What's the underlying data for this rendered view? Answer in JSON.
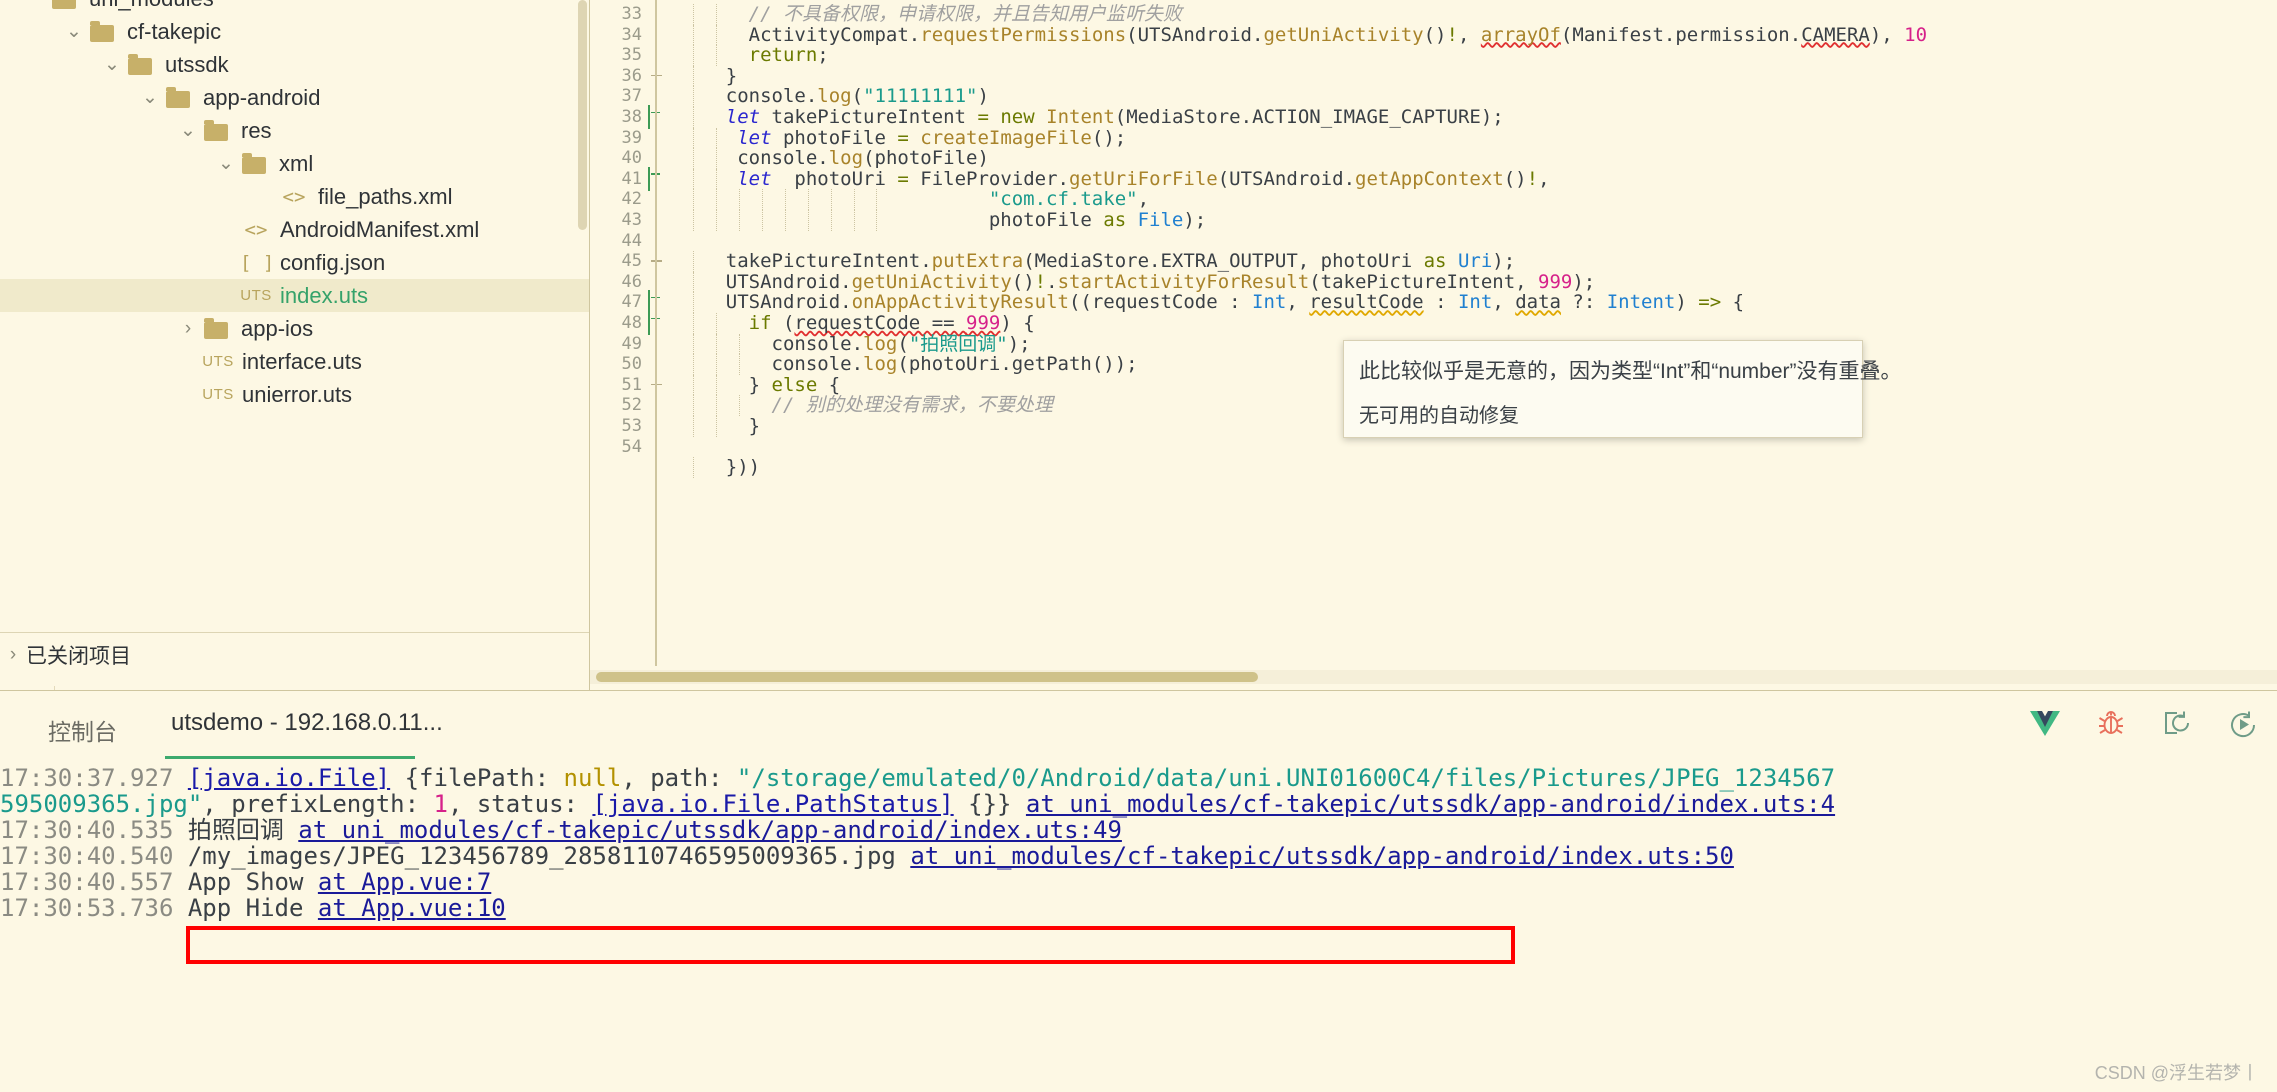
{
  "sidebar": {
    "tree": [
      {
        "indent": 0,
        "twisty": "",
        "icon": "folder",
        "label": "uni_modules",
        "selected": false,
        "clipped": true
      },
      {
        "indent": 1,
        "twisty": "chevron-down",
        "icon": "folder",
        "label": "cf-takepic",
        "selected": false
      },
      {
        "indent": 2,
        "twisty": "chevron-down",
        "icon": "folder",
        "label": "utssdk",
        "selected": false
      },
      {
        "indent": 3,
        "twisty": "chevron-down",
        "icon": "folder",
        "label": "app-android",
        "selected": false
      },
      {
        "indent": 4,
        "twisty": "chevron-down",
        "icon": "folder",
        "label": "res",
        "selected": false
      },
      {
        "indent": 5,
        "twisty": "chevron-down",
        "icon": "folder",
        "label": "xml",
        "selected": false
      },
      {
        "indent": 6,
        "twisty": "",
        "icon": "code",
        "label": "file_paths.xml",
        "selected": false
      },
      {
        "indent": 5,
        "twisty": "",
        "icon": "code",
        "label": "AndroidManifest.xml",
        "selected": false
      },
      {
        "indent": 5,
        "twisty": "",
        "icon": "json",
        "label": "config.json",
        "selected": false
      },
      {
        "indent": 5,
        "twisty": "",
        "icon": "uts",
        "label": "index.uts",
        "selected": true
      },
      {
        "indent": 4,
        "twisty": "chevron-right",
        "icon": "folder",
        "label": "app-ios",
        "selected": false
      },
      {
        "indent": 4,
        "twisty": "",
        "icon": "uts",
        "label": "interface.uts",
        "selected": false
      },
      {
        "indent": 4,
        "twisty": "",
        "icon": "uts",
        "label": "unierror.uts",
        "selected": false
      }
    ],
    "closed_projects": {
      "twisty": "chevron-right",
      "label": "已关闭项目"
    },
    "toolbar": [
      {
        "name": "project-manager-icon",
        "glyph": "folder-lines"
      },
      {
        "name": "binoculars-icon",
        "glyph": "binoculars"
      },
      {
        "name": "bug-icon",
        "glyph": "bug"
      },
      {
        "name": "run-icon",
        "glyph": "run-arrow"
      },
      {
        "name": "cloud-globe-icon",
        "glyph": "cloud-globe"
      }
    ]
  },
  "editor": {
    "lines": [
      {
        "num": "33",
        "fold": "",
        "indent": 2,
        "tokens": [
          {
            "t": "      // 不具备权限，申请权限，并且告知用户监听失败",
            "c": "c-cmt"
          }
        ]
      },
      {
        "num": "34",
        "fold": "",
        "indent": 2,
        "tokens": [
          {
            "t": "      ",
            "c": "c-pln"
          },
          {
            "t": "ActivityCompat",
            "c": "c-pln"
          },
          {
            "t": ".",
            "c": "c-punct"
          },
          {
            "t": "requestPermissions",
            "c": "c-fn"
          },
          {
            "t": "(",
            "c": "c-punct"
          },
          {
            "t": "UTSAndroid",
            "c": "c-pln"
          },
          {
            "t": ".",
            "c": "c-punct"
          },
          {
            "t": "getUniActivity",
            "c": "c-fn"
          },
          {
            "t": "()",
            "c": "c-punct"
          },
          {
            "t": "!",
            "c": "c-op"
          },
          {
            "t": ", ",
            "c": "c-punct"
          },
          {
            "t": "arrayOf",
            "c": "c-fn sq-red"
          },
          {
            "t": "(",
            "c": "c-punct"
          },
          {
            "t": "Manifest",
            "c": "c-pln"
          },
          {
            "t": ".",
            "c": "c-punct"
          },
          {
            "t": "permission",
            "c": "c-pln"
          },
          {
            "t": ".",
            "c": "c-punct"
          },
          {
            "t": "CAMERA",
            "c": "c-pln sq-red"
          },
          {
            "t": "), ",
            "c": "c-punct"
          },
          {
            "t": "10",
            "c": "c-num"
          }
        ]
      },
      {
        "num": "35",
        "fold": "",
        "indent": 2,
        "tokens": [
          {
            "t": "      ",
            "c": "c-pln"
          },
          {
            "t": "return",
            "c": "c-kw2"
          },
          {
            "t": ";",
            "c": "c-punct"
          }
        ]
      },
      {
        "num": "36",
        "fold": "dash",
        "indent": 1,
        "tokens": [
          {
            "t": "    }",
            "c": "c-punct"
          }
        ]
      },
      {
        "num": "37",
        "fold": "",
        "indent": 1,
        "tokens": [
          {
            "t": "    console",
            "c": "c-pln"
          },
          {
            "t": ".",
            "c": "c-punct"
          },
          {
            "t": "log",
            "c": "c-fn"
          },
          {
            "t": "(",
            "c": "c-punct"
          },
          {
            "t": "\"11111111\"",
            "c": "c-str"
          },
          {
            "t": ")",
            "c": "c-punct"
          }
        ]
      },
      {
        "num": "38",
        "fold": "box",
        "indent": 1,
        "tokens": [
          {
            "t": "    ",
            "c": "c-pln"
          },
          {
            "t": "let",
            "c": "c-kw"
          },
          {
            "t": " takePictureIntent ",
            "c": "c-pln"
          },
          {
            "t": "=",
            "c": "c-op"
          },
          {
            "t": " ",
            "c": "c-pln"
          },
          {
            "t": "new",
            "c": "c-kw2"
          },
          {
            "t": " ",
            "c": "c-pln"
          },
          {
            "t": "Intent",
            "c": "c-fn"
          },
          {
            "t": "(",
            "c": "c-punct"
          },
          {
            "t": "MediaStore",
            "c": "c-pln"
          },
          {
            "t": ".",
            "c": "c-punct"
          },
          {
            "t": "ACTION_IMAGE_CAPTURE",
            "c": "c-pln"
          },
          {
            "t": ");",
            "c": "c-punct"
          }
        ]
      },
      {
        "num": "39",
        "fold": "",
        "indent": 2,
        "tokens": [
          {
            "t": "     ",
            "c": "c-pln"
          },
          {
            "t": "let",
            "c": "c-kw"
          },
          {
            "t": " photoFile ",
            "c": "c-pln"
          },
          {
            "t": "=",
            "c": "c-op"
          },
          {
            "t": " ",
            "c": "c-pln"
          },
          {
            "t": "createImageFile",
            "c": "c-fn"
          },
          {
            "t": "();",
            "c": "c-punct"
          }
        ]
      },
      {
        "num": "40",
        "fold": "",
        "indent": 2,
        "tokens": [
          {
            "t": "     console",
            "c": "c-pln"
          },
          {
            "t": ".",
            "c": "c-punct"
          },
          {
            "t": "log",
            "c": "c-fn"
          },
          {
            "t": "(photoFile)",
            "c": "c-punct"
          }
        ]
      },
      {
        "num": "41",
        "fold": "box",
        "indent": 2,
        "tokens": [
          {
            "t": "     ",
            "c": "c-pln"
          },
          {
            "t": "let",
            "c": "c-kw"
          },
          {
            "t": "  photoUri ",
            "c": "c-pln"
          },
          {
            "t": "=",
            "c": "c-op"
          },
          {
            "t": " FileProvider",
            "c": "c-pln"
          },
          {
            "t": ".",
            "c": "c-punct"
          },
          {
            "t": "getUriForFile",
            "c": "c-fn"
          },
          {
            "t": "(",
            "c": "c-punct"
          },
          {
            "t": "UTSAndroid",
            "c": "c-pln"
          },
          {
            "t": ".",
            "c": "c-punct"
          },
          {
            "t": "getAppContext",
            "c": "c-fn"
          },
          {
            "t": "()",
            "c": "c-punct"
          },
          {
            "t": "!",
            "c": "c-op"
          },
          {
            "t": ",",
            "c": "c-punct"
          }
        ]
      },
      {
        "num": "42",
        "fold": "",
        "indent": 9,
        "tokens": [
          {
            "t": "                           ",
            "c": "c-pln"
          },
          {
            "t": "\"com.cf.take\"",
            "c": "c-str"
          },
          {
            "t": ",",
            "c": "c-punct"
          }
        ]
      },
      {
        "num": "43",
        "fold": "",
        "indent": 9,
        "tokens": [
          {
            "t": "                           photoFile ",
            "c": "c-pln"
          },
          {
            "t": "as",
            "c": "c-op"
          },
          {
            "t": " ",
            "c": "c-pln"
          },
          {
            "t": "File",
            "c": "c-type"
          },
          {
            "t": ");",
            "c": "c-punct"
          }
        ]
      },
      {
        "num": "44",
        "fold": "",
        "indent": 0,
        "tokens": [
          {
            "t": "",
            "c": "c-pln"
          }
        ]
      },
      {
        "num": "45",
        "fold": "dash",
        "indent": 1,
        "tokens": [
          {
            "t": "    takePictureIntent",
            "c": "c-pln"
          },
          {
            "t": ".",
            "c": "c-punct"
          },
          {
            "t": "putExtra",
            "c": "c-fn"
          },
          {
            "t": "(",
            "c": "c-punct"
          },
          {
            "t": "MediaStore",
            "c": "c-pln"
          },
          {
            "t": ".",
            "c": "c-punct"
          },
          {
            "t": "EXTRA_OUTPUT",
            "c": "c-pln"
          },
          {
            "t": ", photoUri ",
            "c": "c-punct"
          },
          {
            "t": "as",
            "c": "c-op"
          },
          {
            "t": " ",
            "c": "c-pln"
          },
          {
            "t": "Uri",
            "c": "c-type"
          },
          {
            "t": ");",
            "c": "c-punct"
          }
        ]
      },
      {
        "num": "46",
        "fold": "",
        "indent": 1,
        "tokens": [
          {
            "t": "    UTSAndroid",
            "c": "c-pln"
          },
          {
            "t": ".",
            "c": "c-punct"
          },
          {
            "t": "getUniActivity",
            "c": "c-fn"
          },
          {
            "t": "()",
            "c": "c-punct"
          },
          {
            "t": "!",
            "c": "c-op"
          },
          {
            "t": ".",
            "c": "c-punct"
          },
          {
            "t": "startActivityForResult",
            "c": "c-fn"
          },
          {
            "t": "(takePictureIntent, ",
            "c": "c-punct"
          },
          {
            "t": "999",
            "c": "c-num"
          },
          {
            "t": ");",
            "c": "c-punct"
          }
        ]
      },
      {
        "num": "47",
        "fold": "box",
        "indent": 1,
        "tokens": [
          {
            "t": "    UTSAndroid",
            "c": "c-pln"
          },
          {
            "t": ".",
            "c": "c-punct"
          },
          {
            "t": "onAppActivityResult",
            "c": "c-fn"
          },
          {
            "t": "((requestCode ",
            "c": "c-punct"
          },
          {
            "t": ":",
            "c": "c-punct"
          },
          {
            "t": " ",
            "c": "c-pln"
          },
          {
            "t": "Int",
            "c": "c-type"
          },
          {
            "t": ", ",
            "c": "c-punct"
          },
          {
            "t": "resultCode",
            "c": "c-pln sq-yel"
          },
          {
            "t": " ",
            "c": "c-pln"
          },
          {
            "t": ":",
            "c": "c-punct"
          },
          {
            "t": " ",
            "c": "c-pln"
          },
          {
            "t": "Int",
            "c": "c-type"
          },
          {
            "t": ", ",
            "c": "c-punct"
          },
          {
            "t": "data",
            "c": "c-pln sq-yel"
          },
          {
            "t": " ?: ",
            "c": "c-punct"
          },
          {
            "t": "Intent",
            "c": "c-type"
          },
          {
            "t": ") ",
            "c": "c-punct"
          },
          {
            "t": "=>",
            "c": "c-op"
          },
          {
            "t": " {",
            "c": "c-punct"
          }
        ]
      },
      {
        "num": "48",
        "fold": "box",
        "indent": 2,
        "tokens": [
          {
            "t": "      ",
            "c": "c-pln"
          },
          {
            "t": "if",
            "c": "c-kw2"
          },
          {
            "t": " (",
            "c": "c-punct"
          },
          {
            "t": "requestCode == ",
            "c": "c-pln sq-red"
          },
          {
            "t": "999",
            "c": "c-num sq-red"
          },
          {
            "t": ") {",
            "c": "c-punct"
          }
        ]
      },
      {
        "num": "49",
        "fold": "",
        "indent": 3,
        "tokens": [
          {
            "t": "        console",
            "c": "c-pln"
          },
          {
            "t": ".",
            "c": "c-punct"
          },
          {
            "t": "log",
            "c": "c-fn"
          },
          {
            "t": "(",
            "c": "c-punct"
          },
          {
            "t": "\"拍照回调\"",
            "c": "c-str"
          },
          {
            "t": ");",
            "c": "c-punct"
          }
        ]
      },
      {
        "num": "50",
        "fold": "",
        "indent": 3,
        "tokens": [
          {
            "t": "        console",
            "c": "c-pln"
          },
          {
            "t": ".",
            "c": "c-punct"
          },
          {
            "t": "log",
            "c": "c-fn"
          },
          {
            "t": "(photoUri.getPath());",
            "c": "c-punct"
          }
        ]
      },
      {
        "num": "51",
        "fold": "dash",
        "indent": 2,
        "tokens": [
          {
            "t": "      } ",
            "c": "c-punct"
          },
          {
            "t": "else",
            "c": "c-kw2"
          },
          {
            "t": " {",
            "c": "c-punct"
          }
        ]
      },
      {
        "num": "52",
        "fold": "",
        "indent": 3,
        "tokens": [
          {
            "t": "        // 别的处理没有需求，不要处理",
            "c": "c-cmt"
          }
        ]
      },
      {
        "num": "53",
        "fold": "",
        "indent": 2,
        "tokens": [
          {
            "t": "      }",
            "c": "c-punct"
          }
        ]
      },
      {
        "num": "54",
        "fold": "",
        "indent": 0,
        "tokens": [
          {
            "t": "",
            "c": "c-pln"
          }
        ]
      },
      {
        "num": "",
        "fold": "",
        "indent": 1,
        "tokens": [
          {
            "t": "    }))",
            "c": "c-punct"
          }
        ]
      }
    ],
    "tooltip": {
      "message": "此比较似乎是无意的，因为类型“Int”和“number”没有重叠。",
      "action": "无可用的自动修复"
    }
  },
  "console": {
    "title": "控制台",
    "tab_label": "utsdemo - 192.168.0.11...",
    "icons": [
      {
        "name": "vue-logo-icon"
      },
      {
        "name": "bug-icon"
      },
      {
        "name": "clear-console-icon"
      },
      {
        "name": "play-refresh-icon"
      }
    ],
    "log_lines": [
      [
        {
          "t": "17:30:37.927 ",
          "c": "ts"
        },
        {
          "t": "[java.io.File]",
          "c": "lnk"
        },
        {
          "t": " {filePath: ",
          "c": ""
        },
        {
          "t": "null",
          "c": "yel"
        },
        {
          "t": ", path: ",
          "c": ""
        },
        {
          "t": "\"/storage/emulated/0/Android/data/uni.UNI01600C4/files/Pictures/JPEG_1234567",
          "c": "teal"
        }
      ],
      [
        {
          "t": "595009365.jpg\"",
          "c": "teal"
        },
        {
          "t": ", prefixLength: ",
          "c": ""
        },
        {
          "t": "1",
          "c": "pink"
        },
        {
          "t": ", status: ",
          "c": ""
        },
        {
          "t": "[java.io.File.PathStatus]",
          "c": "lnk"
        },
        {
          "t": " {}} ",
          "c": ""
        },
        {
          "t": "at uni_modules/cf-takepic/utssdk/app-android/index.uts:4",
          "c": "lnk2"
        }
      ],
      [
        {
          "t": "17:30:40.535 ",
          "c": "ts"
        },
        {
          "t": "拍照回调 ",
          "c": ""
        },
        {
          "t": "at uni_modules/cf-takepic/utssdk/app-android/index.uts:49",
          "c": "lnk2"
        }
      ],
      [
        {
          "t": "17:30:40.540 ",
          "c": "ts"
        },
        {
          "t": "/my_images/JPEG_123456789_2858110746595009365.jpg ",
          "c": ""
        },
        {
          "t": "at uni_modules/cf-takepic/utssdk/app-android/index.uts:50",
          "c": "lnk2"
        }
      ],
      [
        {
          "t": "17:30:40.557 ",
          "c": "ts"
        },
        {
          "t": "App Show ",
          "c": ""
        },
        {
          "t": "at App.vue:7",
          "c": "lnk2"
        }
      ],
      [
        {
          "t": "17:30:53.736 ",
          "c": "ts"
        },
        {
          "t": "App Hide ",
          "c": ""
        },
        {
          "t": "at App.vue:10",
          "c": "lnk2"
        }
      ]
    ]
  },
  "watermark": "CSDN @浮生若梦丨"
}
